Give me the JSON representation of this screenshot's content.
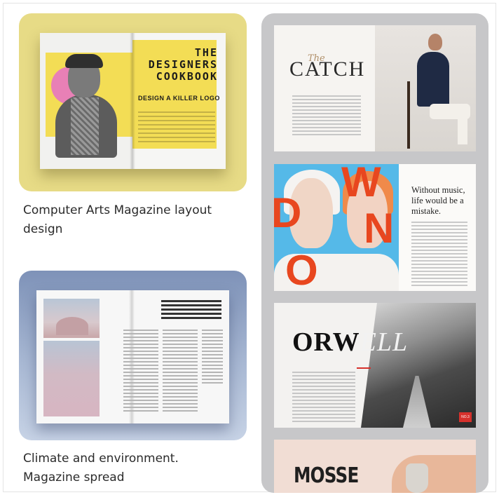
{
  "left_column": {
    "pin_a": {
      "caption": "Computer Arts Magazine layout design",
      "magazine_title": "THE DESIGNERS COOKBOOK",
      "magazine_subtitle": "DESIGN A KILLER LOGO"
    },
    "pin_b": {
      "caption": "Climate and environment. Magazine spread"
    }
  },
  "right_column": {
    "card_catch": {
      "title": "CATCH",
      "script": "The"
    },
    "card_music": {
      "quote": "Without music, life would be a mistake.",
      "art_letters": [
        "D",
        "W",
        "O",
        "N"
      ]
    },
    "card_orwell": {
      "title_dark": "ORW",
      "title_light": "ELL",
      "badge": "NO.3"
    },
    "card_mosse": {
      "title": "MOSSE"
    }
  },
  "colors": {
    "panel_bg": "#c7c7c9",
    "pin_a_bg": "#e7db86",
    "accent_red": "#e8471f",
    "caption_text": "#2b2b2b"
  }
}
